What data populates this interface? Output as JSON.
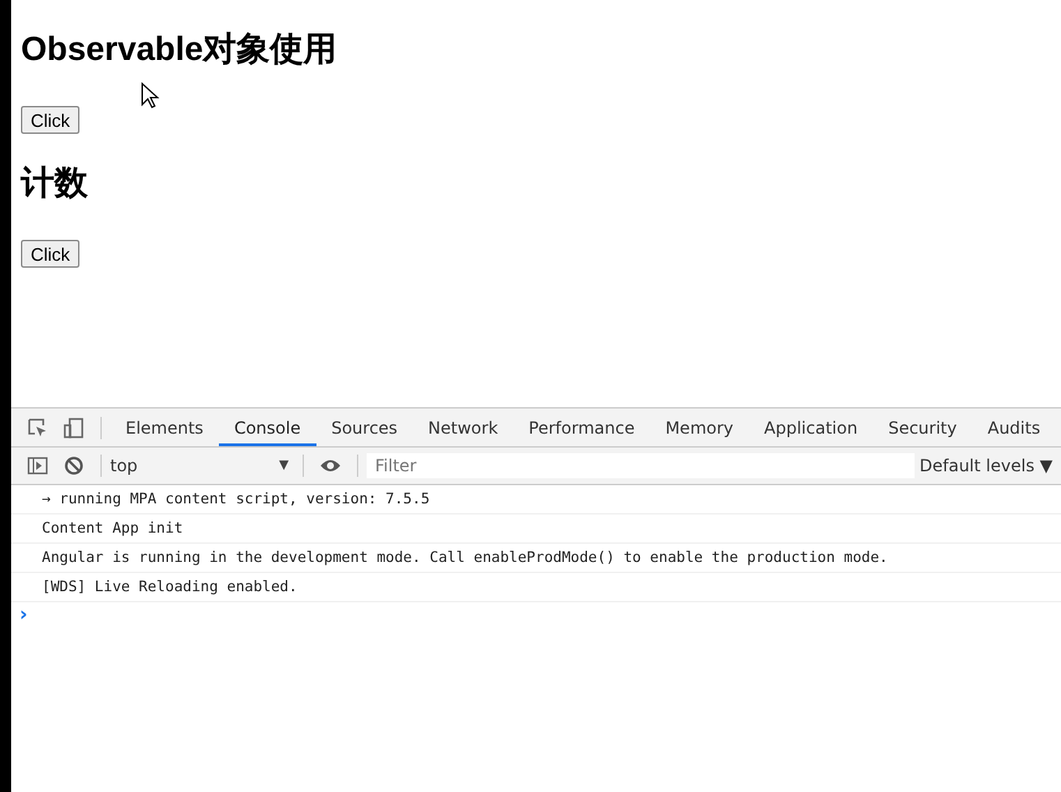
{
  "page": {
    "sections": [
      {
        "heading": "Observable对象使用",
        "button": "Click"
      },
      {
        "heading": "计数",
        "button": "Click"
      }
    ]
  },
  "devtools": {
    "tabs": [
      {
        "label": "Elements",
        "selected": false
      },
      {
        "label": "Console",
        "selected": true
      },
      {
        "label": "Sources",
        "selected": false
      },
      {
        "label": "Network",
        "selected": false
      },
      {
        "label": "Performance",
        "selected": false
      },
      {
        "label": "Memory",
        "selected": false
      },
      {
        "label": "Application",
        "selected": false
      },
      {
        "label": "Security",
        "selected": false
      },
      {
        "label": "Audits",
        "selected": false
      }
    ],
    "context": "top",
    "context_caret": "▼",
    "filter": {
      "placeholder": "Filter"
    },
    "levels": "Default levels ▼",
    "messages": [
      "→ running MPA content script, version: 7.5.5",
      "Content App init",
      "Angular is running in the development mode. Call enableProdMode() to enable the production mode.",
      "[WDS] Live Reloading enabled."
    ],
    "prompt": "›"
  }
}
